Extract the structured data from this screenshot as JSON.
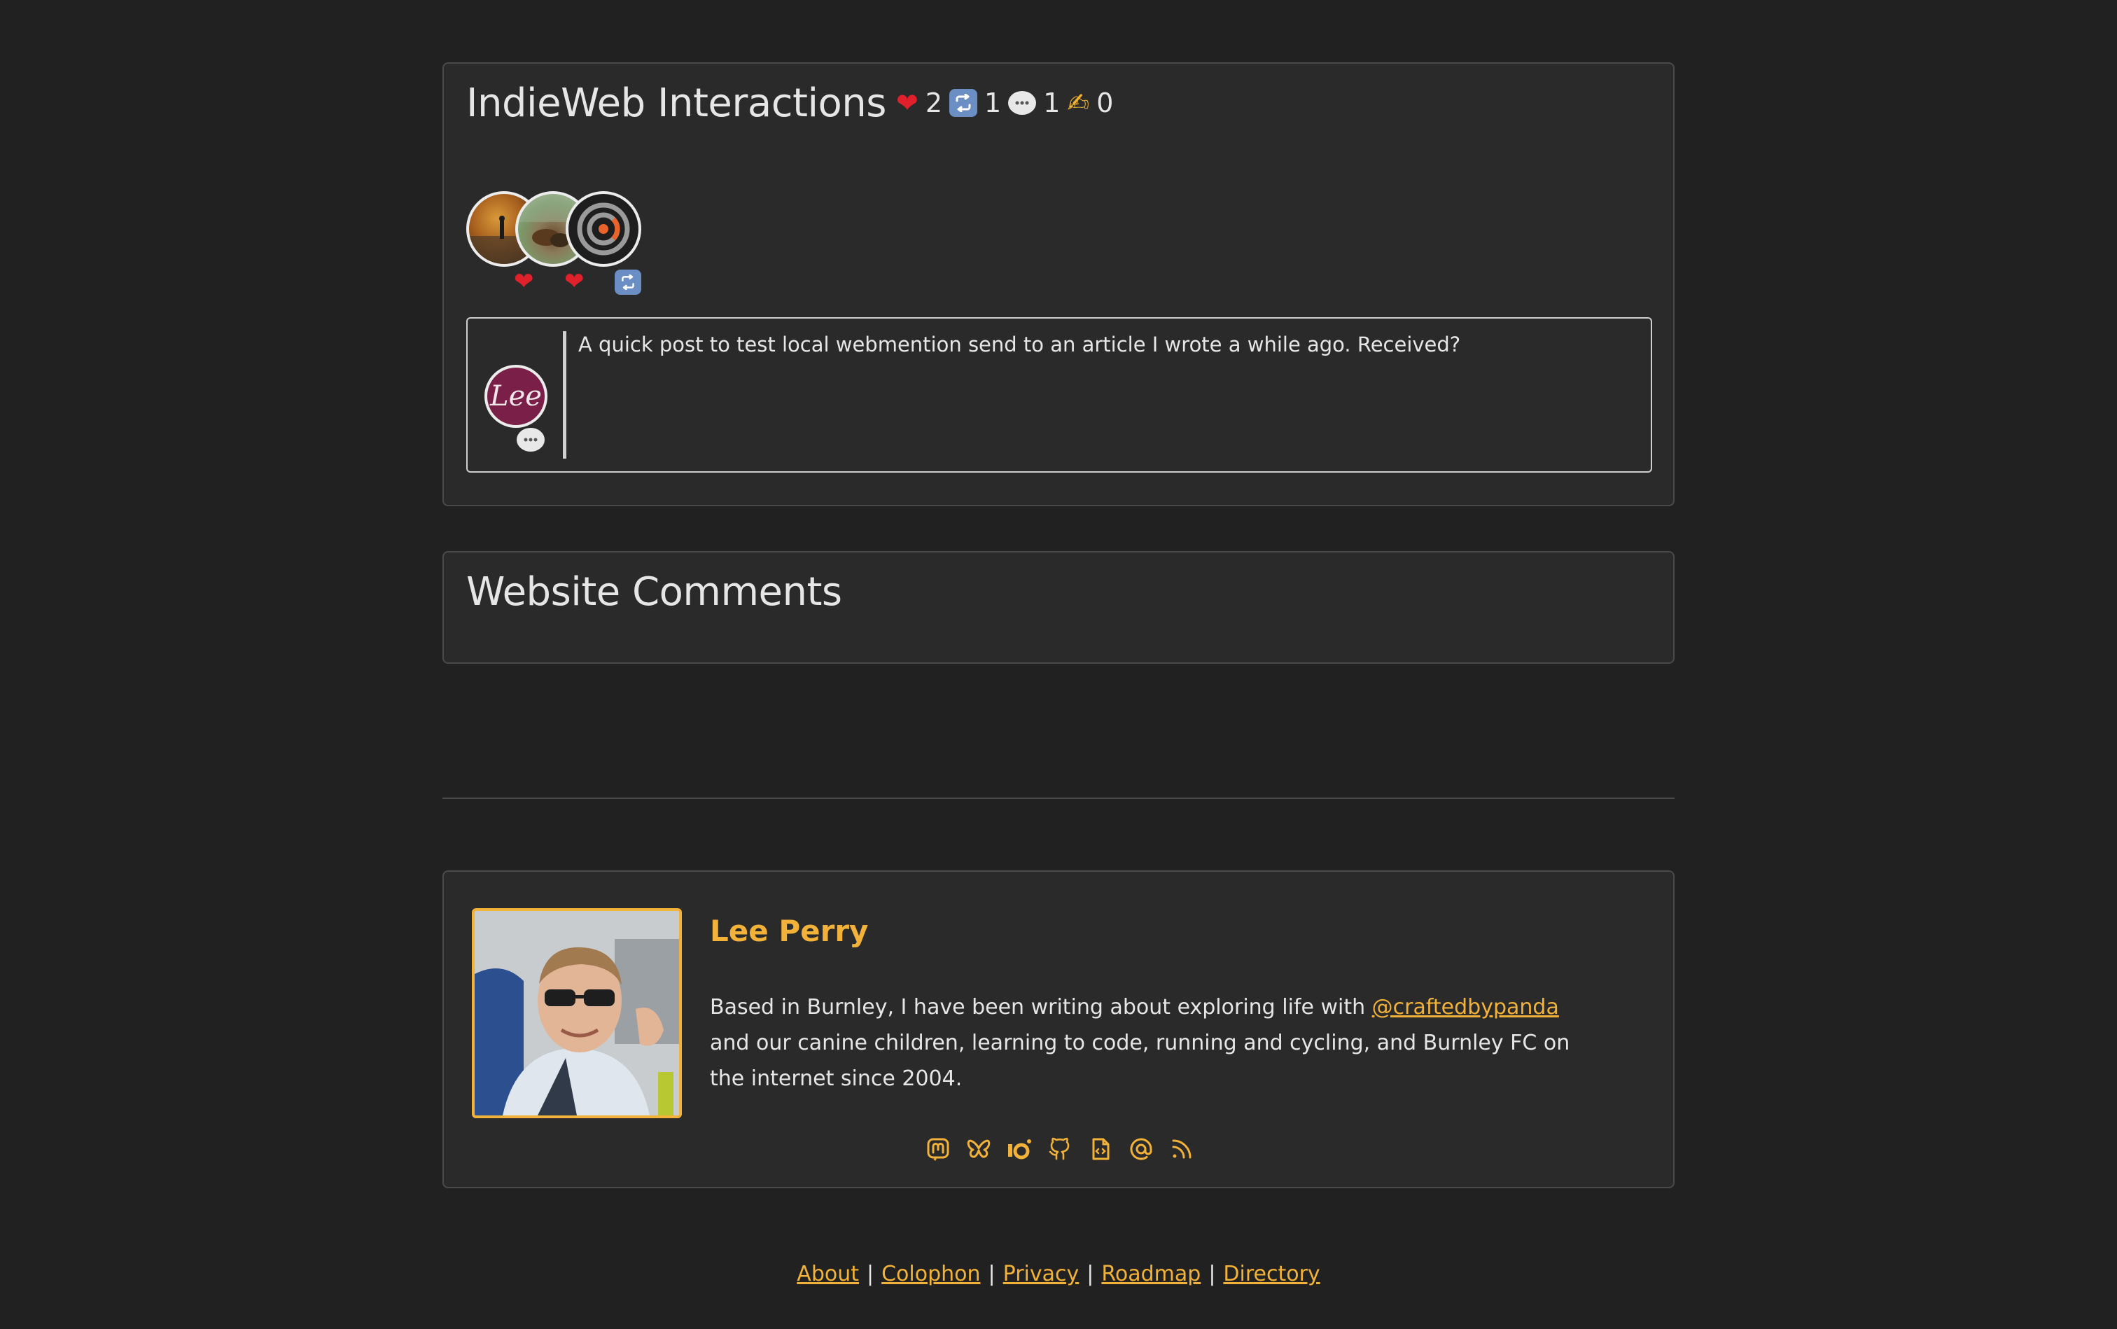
{
  "interactions": {
    "title": "IndieWeb Interactions",
    "counts": {
      "likes": "2",
      "reposts": "1",
      "replies": "1",
      "mentions": "0"
    },
    "mention": {
      "avatar_text": "Lee",
      "text": "A quick post to test local webmention send to an article I wrote a while ago. Received?"
    }
  },
  "comments": {
    "title": "Website Comments"
  },
  "author": {
    "name": "Lee Perry",
    "bio_before": "Based in Burnley, I have been writing about exploring life with ",
    "bio_link": "@craftedbypanda",
    "bio_after": " and our canine children, learning to code, running and cycling, and Burnley FC on the internet since 2004."
  },
  "socials": [
    {
      "icon": "mastodon-icon"
    },
    {
      "icon": "bluesky-butterfly-icon"
    },
    {
      "icon": "micro-blog-icon"
    },
    {
      "icon": "github-icon"
    },
    {
      "icon": "code-file-icon"
    },
    {
      "icon": "email-at-icon"
    },
    {
      "icon": "rss-icon"
    }
  ],
  "footer": {
    "about": "About",
    "colophon": "Colophon",
    "privacy": "Privacy",
    "roadmap": "Roadmap",
    "directory": "Directory",
    "separator": "|"
  },
  "colors": {
    "background": "#212121",
    "card": "#2a2a2a",
    "accent": "#f2b138",
    "heart": "#e0202a"
  }
}
